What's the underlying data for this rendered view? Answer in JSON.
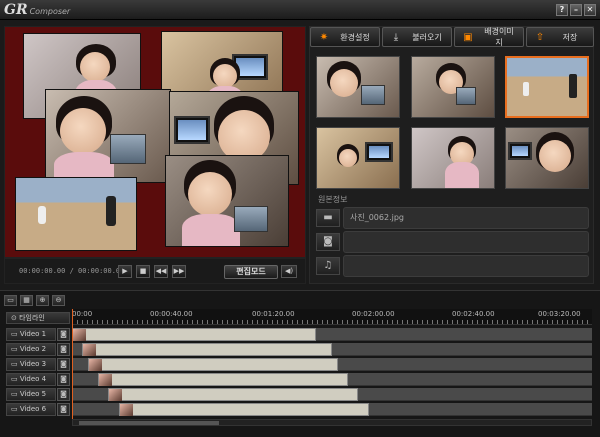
{
  "app": {
    "logo": "GR",
    "logo_sub": "Composer"
  },
  "window_buttons": [
    "?",
    "–",
    "✕"
  ],
  "playback": {
    "timecode": "00:00:00.00 / 00:00:00.00",
    "controls": [
      "▶",
      "■",
      "◀◀",
      "▶▶"
    ],
    "edit_mode": "편집모드",
    "volume": "◀)"
  },
  "toolbar": {
    "settings": "환경설정",
    "import": "불러오기",
    "background": "배경이미지",
    "save": "저장"
  },
  "original_info": {
    "label": "원본정보",
    "filename": "사진_0062.jpg",
    "field2": "",
    "field3": ""
  },
  "timeline": {
    "tools": [
      "▭",
      "▦",
      "⊕",
      "⊖"
    ],
    "header_label": "타임라인",
    "ticks": [
      "00:00",
      "00:00:40.00",
      "00:01:20.00",
      "00:02:00.00",
      "00:02:40.00",
      "00:03:20.00"
    ],
    "tracks": [
      {
        "name": "Video 1",
        "clip_start": 0.0,
        "clip_end": 0.47
      },
      {
        "name": "Video 2",
        "clip_start": 0.02,
        "clip_end": 0.5
      },
      {
        "name": "Video 3",
        "clip_start": 0.03,
        "clip_end": 0.51
      },
      {
        "name": "Video 4",
        "clip_start": 0.05,
        "clip_end": 0.53
      },
      {
        "name": "Video 5",
        "clip_start": 0.07,
        "clip_end": 0.55
      },
      {
        "name": "Video 6",
        "clip_start": 0.09,
        "clip_end": 0.57
      }
    ]
  },
  "colors": {
    "accent": "#e86e1f",
    "preview_bg": "#5a0c0c",
    "clip": "#d0cdc0"
  }
}
